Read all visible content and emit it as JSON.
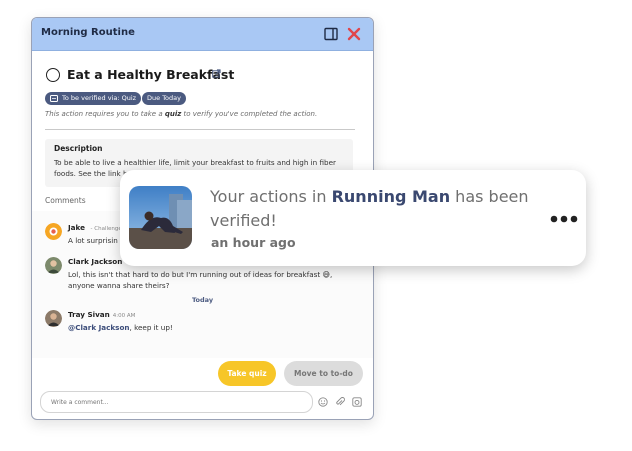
{
  "panel": {
    "title": "Morning Routine",
    "task_title": "Eat a Healthy Breakfast",
    "badges": {
      "quiz": "To be verified via: Quiz",
      "due": "Due Today"
    },
    "requirement": {
      "before": "This action requires you to take a ",
      "bold": "quiz",
      "after": " to verify you've completed the action."
    },
    "description_label": "Description",
    "description_text": "To be able to live a healthier life, limit your breakfast to fruits and high in fiber foods. See the link be",
    "comments_label": "Comments",
    "comments": [
      {
        "name": "Jake",
        "meta": "- Challenge",
        "text": "A lot surprisin"
      },
      {
        "name": "Clark Jackson",
        "meta": "",
        "text": "Lol, this isn't that hard to do but I'm running out of ideas for breakfast 😅, anyone wanna share theirs?"
      },
      {
        "name": "Tray Sivan",
        "meta": "4:00 AM",
        "mention": "@Clark Jackson",
        "text": ", keep it up!"
      }
    ],
    "day_separator": "Today",
    "buttons": {
      "take_quiz": "Take quiz",
      "move_todo": "Move to to-do"
    },
    "composer_placeholder": "Write a comment..."
  },
  "toast": {
    "message_prefix": "Your actions in ",
    "message_bold": "Running Man",
    "message_suffix": " has been verified!",
    "time": "an hour ago"
  },
  "icons": [
    "sidebar-toggle-icon",
    "close-icon",
    "external-link-icon",
    "quiz-icon",
    "emoji-icon",
    "attach-icon",
    "camera-icon",
    "more-options-icon"
  ],
  "colors": {
    "header": "#a9c8f4",
    "accent_yellow": "#f7c628",
    "badge": "#4b5a80",
    "close_red": "#e0454b"
  }
}
